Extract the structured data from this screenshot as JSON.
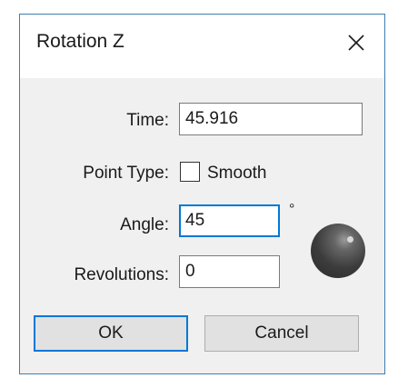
{
  "dialog": {
    "title": "Rotation Z",
    "close_icon": "close-icon"
  },
  "fields": {
    "time": {
      "label": "Time:",
      "value": "45.916"
    },
    "point_type": {
      "label": "Point Type:",
      "checkbox_label": "Smooth",
      "checked": false
    },
    "angle": {
      "label": "Angle:",
      "value": "45",
      "unit": "°"
    },
    "revolutions": {
      "label": "Revolutions:",
      "value": "0"
    }
  },
  "buttons": {
    "ok": "OK",
    "cancel": "Cancel"
  },
  "colors": {
    "accent": "#0078d7",
    "dialog_border": "#3c7fb1",
    "background": "#f0f0f0"
  }
}
